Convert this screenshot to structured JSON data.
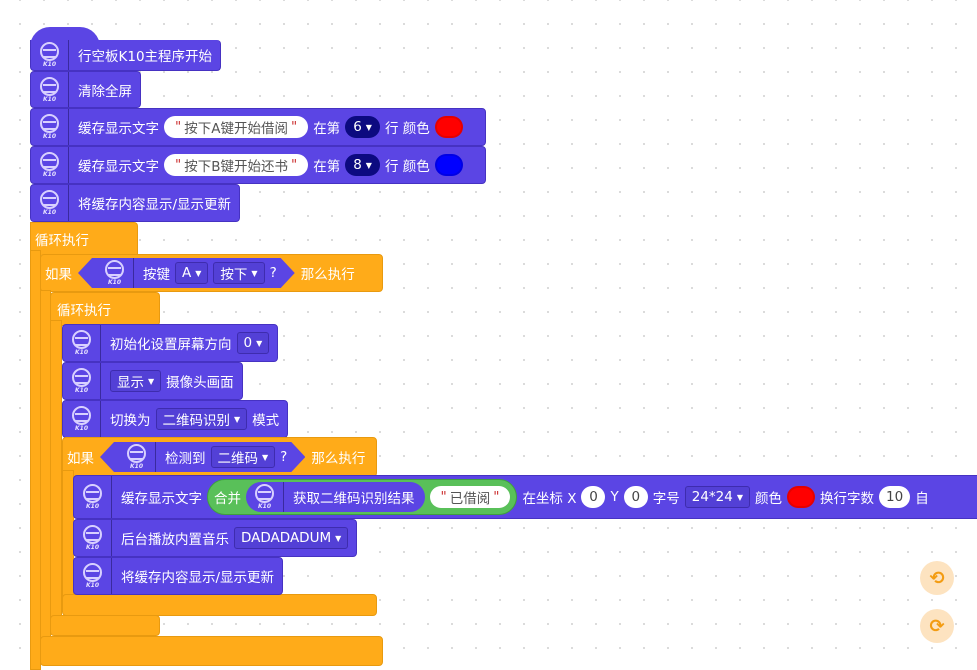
{
  "logo": "K10",
  "hat": {
    "label": "行空板K10主程序开始"
  },
  "clear": {
    "label": "清除全屏"
  },
  "cache1": {
    "label": "缓存显示文字",
    "text": "按下A键开始借阅",
    "at": "在第",
    "row": "6",
    "row_suffix": "行 颜色",
    "color": "#ff0000"
  },
  "cache2": {
    "label": "缓存显示文字",
    "text": "按下B键开始还书",
    "at": "在第",
    "row": "8",
    "row_suffix": "行 颜色",
    "color": "#0000ff"
  },
  "show1": {
    "label": "将缓存内容显示/显示更新"
  },
  "loop1": {
    "label": "循环执行"
  },
  "if1": {
    "if": "如果",
    "key": "按键",
    "key_val": "A",
    "state": "按下",
    "q": "?",
    "then": "那么执行"
  },
  "loop2": {
    "label": "循环执行"
  },
  "init": {
    "label": "初始化设置屏幕方向",
    "val": "0"
  },
  "camera": {
    "mode": "显示",
    "label": "摄像头画面"
  },
  "switch": {
    "label": "切换为",
    "mode": "二维码识别",
    "suffix": "模式"
  },
  "if2": {
    "if": "如果",
    "detect": "检测到",
    "target": "二维码",
    "q": "?",
    "then": "那么执行"
  },
  "cache3": {
    "label": "缓存显示文字",
    "join": "合并",
    "result": "获取二维码识别结果",
    "text": "已借阅",
    "coord": "在坐标 X",
    "x": "0",
    "y_label": "Y",
    "y": "0",
    "font": "字号",
    "font_val": "24*24",
    "color_label": "颜色",
    "color": "#ff0000",
    "wrap": "换行字数",
    "wrap_val": "10",
    "tail": "自"
  },
  "music": {
    "label": "后台播放内置音乐",
    "val": "DADADADUM"
  },
  "show2": {
    "label": "将缓存内容显示/显示更新"
  },
  "controls": {
    "undo": "undo-icon",
    "redo": "redo-icon",
    "accent": "#f39c12"
  },
  "colors": {
    "motion": "#5b45e4",
    "control": "#ffab19",
    "operator": "#59c059"
  }
}
